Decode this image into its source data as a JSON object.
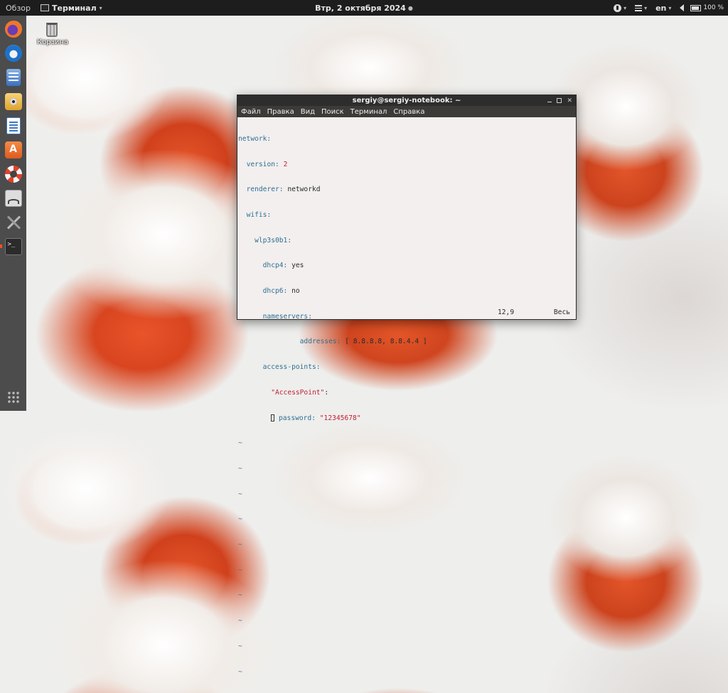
{
  "topbar": {
    "overview": "Обзор",
    "app_menu": "Терминал",
    "datetime": "Втр, 2 октября 2024",
    "language": "en",
    "battery": "100 %"
  },
  "dock": {
    "items": [
      {
        "name": "firefox",
        "icon": "firefox-icon"
      },
      {
        "name": "thunderbird",
        "icon": "thunderbird-icon"
      },
      {
        "name": "files",
        "icon": "files-icon"
      },
      {
        "name": "rhythmbox",
        "icon": "rhythmbox-icon"
      },
      {
        "name": "libreoffice-writer",
        "icon": "writer-icon"
      },
      {
        "name": "software",
        "icon": "software-icon"
      },
      {
        "name": "help",
        "icon": "help-icon"
      },
      {
        "name": "system-monitor",
        "icon": "system-monitor-icon"
      },
      {
        "name": "tools",
        "icon": "tools-icon"
      },
      {
        "name": "terminal",
        "icon": "terminal-icon",
        "active": true
      }
    ]
  },
  "desktop": {
    "trash_label": "Корзина"
  },
  "window": {
    "title": "sergiy@sergiy-notebook: ~",
    "menu": [
      "Файл",
      "Правка",
      "Вид",
      "Поиск",
      "Терминал",
      "Справка"
    ]
  },
  "editor": {
    "network_key": "network:",
    "version_key": "version:",
    "version_val": "2",
    "renderer_key": "renderer:",
    "renderer_val": "networkd",
    "wifis_key": "wifis:",
    "iface_key": "wlp3s0b1:",
    "dhcp4_key": "dhcp4:",
    "dhcp4_val": "yes",
    "dhcp6_key": "dhcp6:",
    "dhcp6_val": "no",
    "ns_key": "nameservers:",
    "addresses_key": "addresses:",
    "addresses_val": "[ 8.8.8.8, 8.8.4.4 ]",
    "ap_key": "access-points:",
    "ap_name": "\"AccessPoint\"",
    "ap_colon": ":",
    "password_key": "password:",
    "password_val": "\"12345678\"",
    "tilde": "~",
    "cursor_pos": "12,9",
    "scroll_pos": "Весь"
  }
}
